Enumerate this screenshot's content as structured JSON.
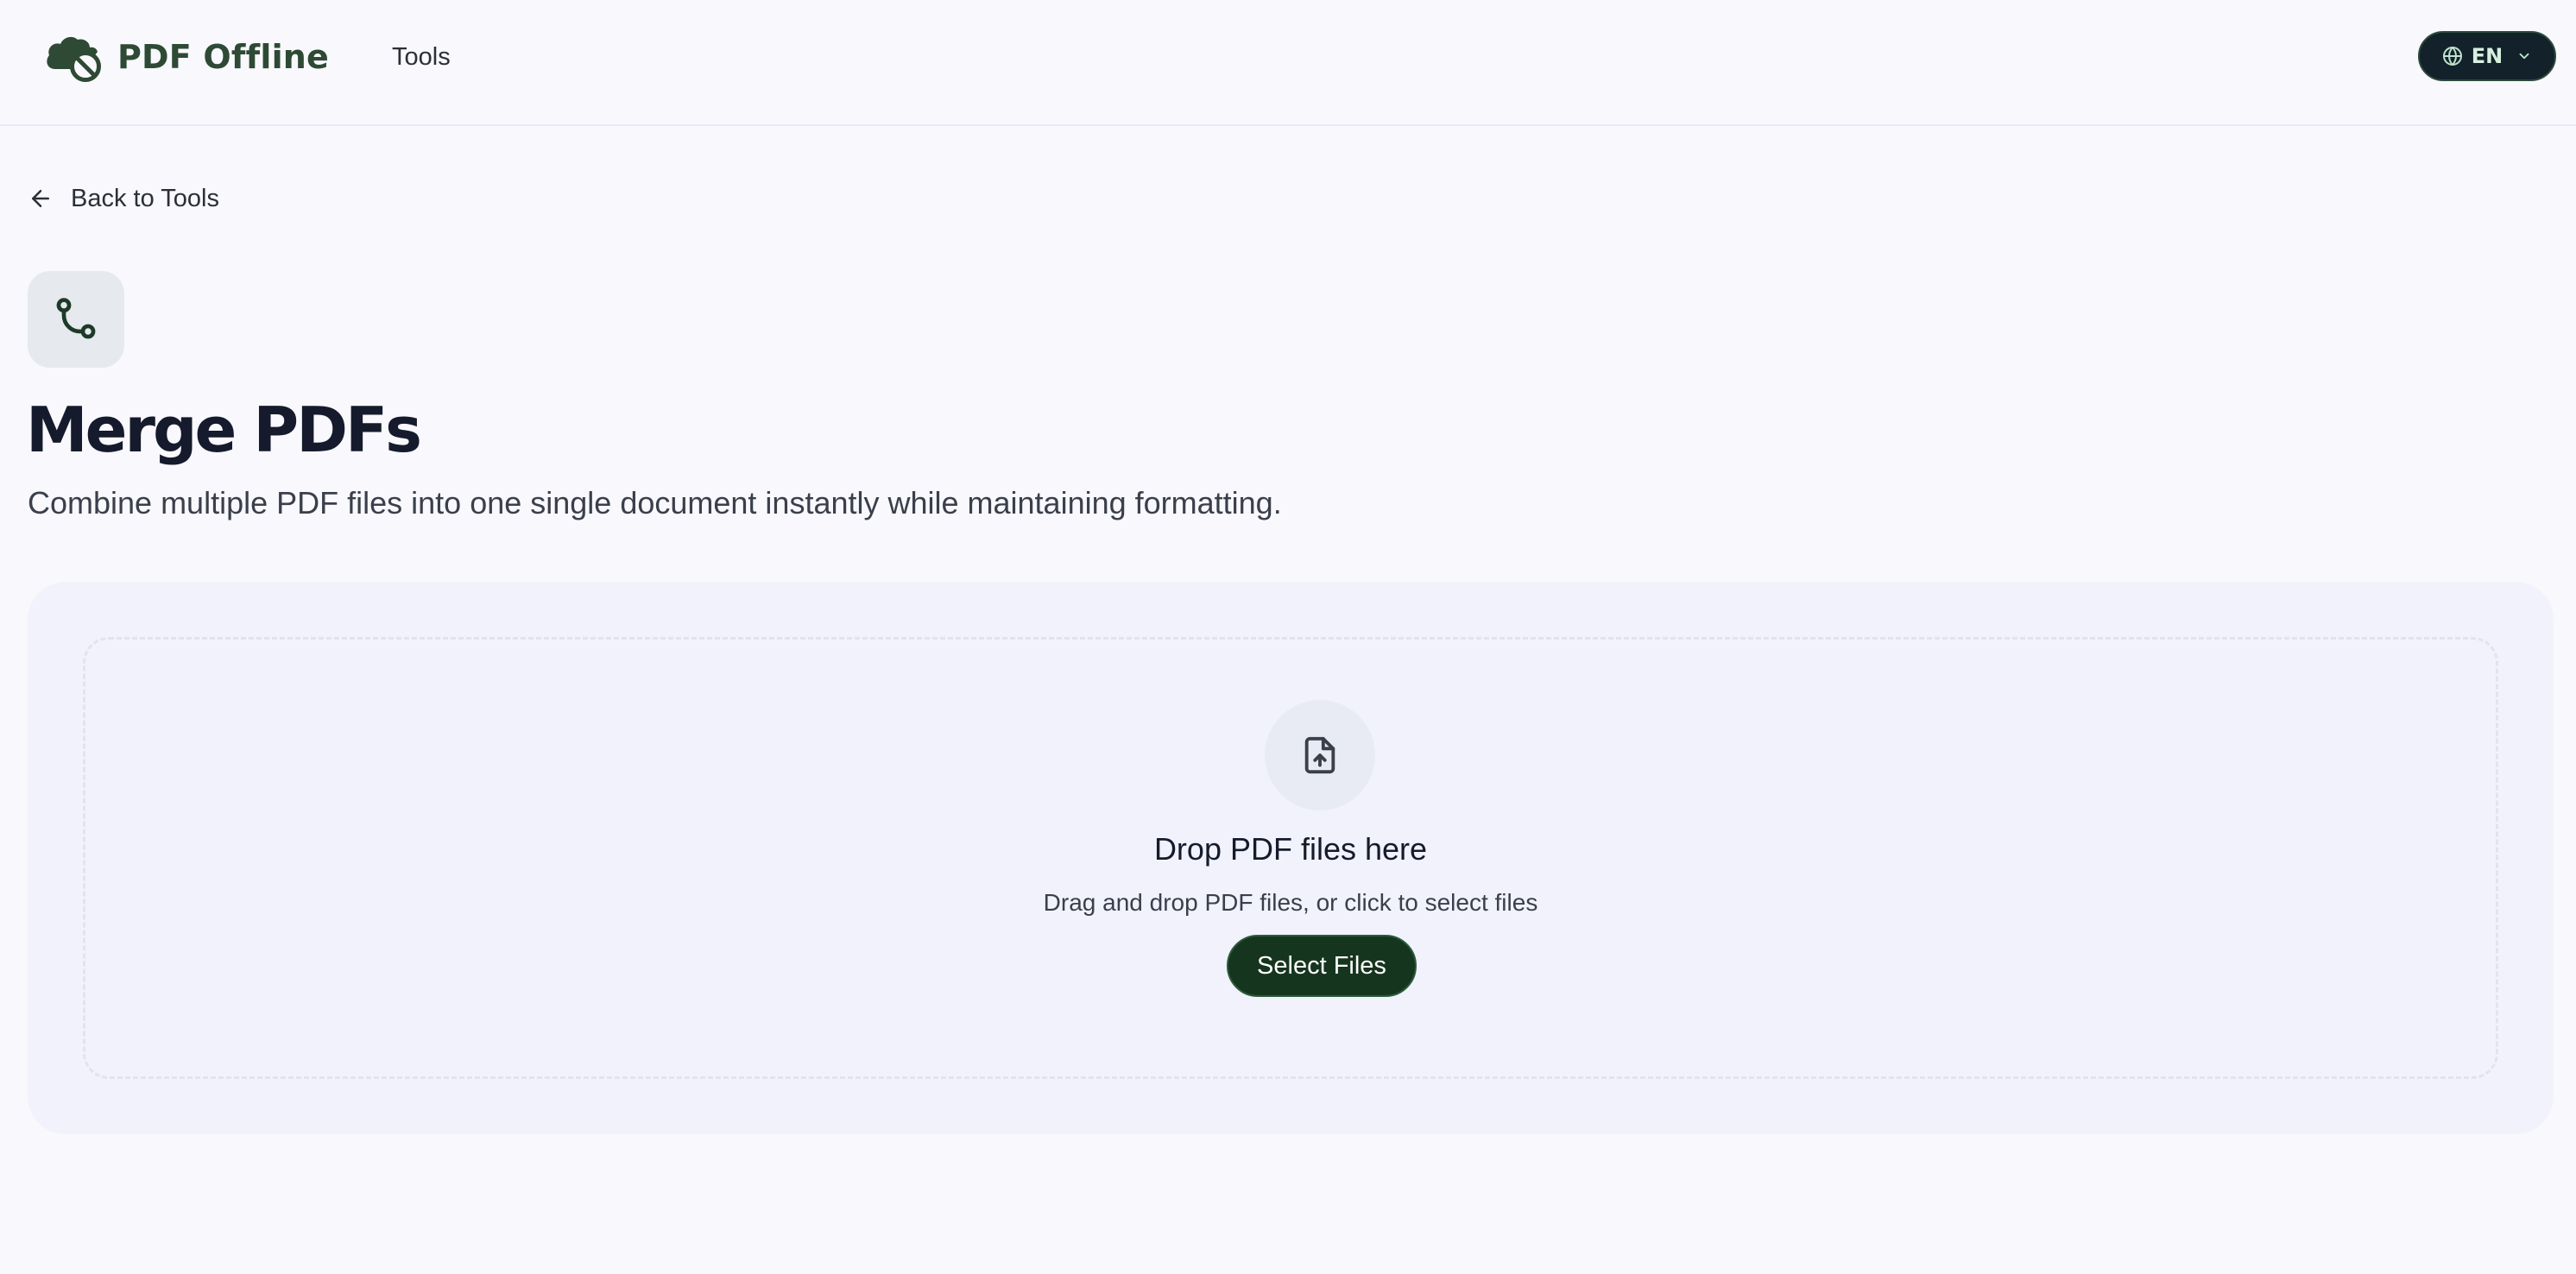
{
  "header": {
    "brand_name": "PDF Offline",
    "nav_tools": "Tools",
    "language_code": "EN"
  },
  "back_link": {
    "label": "Back to Tools"
  },
  "tool": {
    "icon": "git-merge-icon",
    "title": "Merge PDFs",
    "subtitle": "Combine multiple PDF files into one single document instantly while maintaining formatting."
  },
  "upload": {
    "icon": "file-upload-icon",
    "title": "Drop PDF files here",
    "hint": "Drag and drop PDF files, or click to select files",
    "button_label": "Select Files"
  },
  "colors": {
    "background": "#f8f8fd",
    "brand_green": "#2e4a34",
    "primary_button": "#16351f",
    "language_button": "#13212b",
    "card_background": "#f1f2fc"
  }
}
